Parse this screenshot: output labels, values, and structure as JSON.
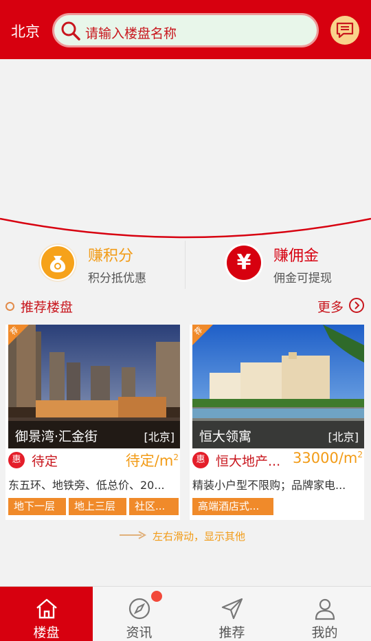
{
  "header": {
    "city": "北京",
    "search_placeholder": "请输入楼盘名称"
  },
  "features": [
    {
      "title": "赚积分",
      "subtitle": "积分抵优惠",
      "icon": "coin-bag-icon"
    },
    {
      "title": "赚佣金",
      "subtitle": "佣金可提现",
      "icon": "yen-icon",
      "icon_glyph": "¥"
    }
  ],
  "section": {
    "title": "推荐楼盘",
    "more": "更多"
  },
  "cards": [
    {
      "corner": "荐",
      "name": "御景湾·汇金街",
      "city": "[北京]",
      "badge": "惠",
      "status": "待定",
      "price": "待定/m",
      "price_sup": "2",
      "desc": "东五环、地铁旁、低总价、20...",
      "tags": [
        "地下一层",
        "地上三层",
        "社区..."
      ]
    },
    {
      "corner": "荐",
      "name": "恒大领寓",
      "city": "[北京]",
      "badge": "惠",
      "status": "恒大地产...",
      "price": "33000/m",
      "price_sup": "2",
      "desc": "精装小户型不限购；品牌家电...",
      "tags": [
        "高端酒店式..."
      ]
    }
  ],
  "swipe_hint": "左右滑动，显示其他",
  "nav": [
    {
      "label": "楼盘",
      "icon": "home-icon",
      "active": true
    },
    {
      "label": "资讯",
      "icon": "compass-icon",
      "active": false
    },
    {
      "label": "推荐",
      "icon": "send-icon",
      "active": false
    },
    {
      "label": "我的",
      "icon": "user-icon",
      "active": false
    }
  ],
  "colors": {
    "primary": "#d7000f",
    "accent": "#f29b16",
    "tag": "#f08a2a"
  }
}
